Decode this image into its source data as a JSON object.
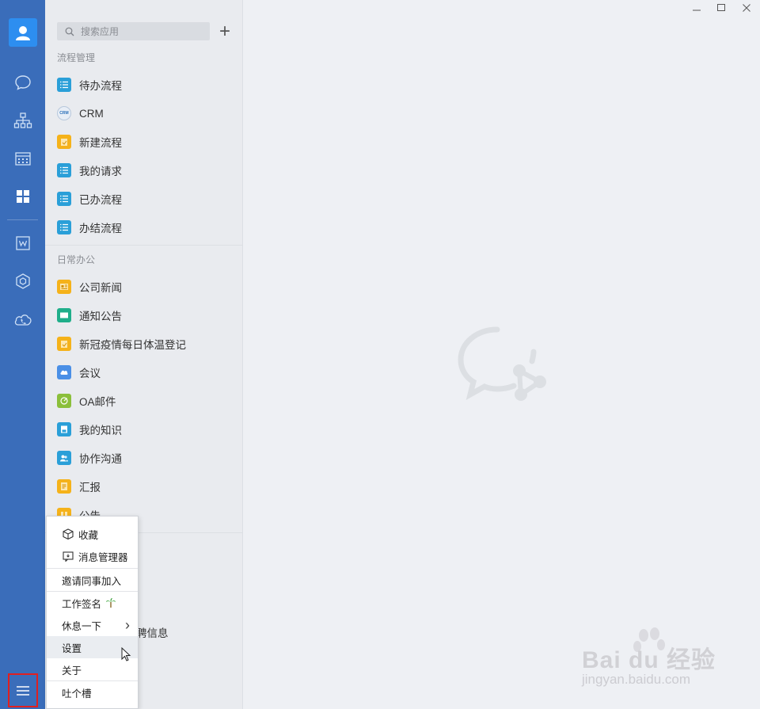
{
  "window": {
    "minimize_symbol": "—",
    "maximize_symbol": "☐",
    "close_symbol": "✕"
  },
  "rail": {
    "items": [
      {
        "name": "chat-icon"
      },
      {
        "name": "org-chart-icon"
      },
      {
        "name": "calendar-icon"
      },
      {
        "name": "apps-grid-icon"
      },
      {
        "name": "doc-w-icon"
      },
      {
        "name": "cube-icon"
      },
      {
        "name": "phone-cloud-icon"
      }
    ]
  },
  "panel": {
    "search_placeholder": "搜索应用",
    "add_symbol": "+",
    "sections": [
      {
        "title": "流程管理",
        "items": [
          {
            "label": "待办流程",
            "color": "#2a9fd8",
            "icon": "list-icon"
          },
          {
            "label": "CRM",
            "color": "#e8eef6",
            "icon": "crm-icon"
          },
          {
            "label": "新建流程",
            "color": "#f5b21a",
            "icon": "doc-edit-icon"
          },
          {
            "label": "我的请求",
            "color": "#2a9fd8",
            "icon": "list-icon"
          },
          {
            "label": "已办流程",
            "color": "#2a9fd8",
            "icon": "list-icon"
          },
          {
            "label": "办结流程",
            "color": "#2a9fd8",
            "icon": "list-icon"
          }
        ]
      },
      {
        "title": "日常办公",
        "items": [
          {
            "label": "公司新闻",
            "color": "#f5b21a",
            "icon": "news-icon"
          },
          {
            "label": "通知公告",
            "color": "#1fae8a",
            "icon": "notice-icon"
          },
          {
            "label": "新冠疫情每日体温登记",
            "color": "#f5b21a",
            "icon": "doc-edit-icon"
          },
          {
            "label": "会议",
            "color": "#4a8fe6",
            "icon": "meeting-cloud-icon"
          },
          {
            "label": "OA邮件",
            "color": "#8bbf3b",
            "icon": "mail-icon"
          },
          {
            "label": "我的知识",
            "color": "#2a9fd8",
            "icon": "knowledge-icon"
          },
          {
            "label": "协作沟通",
            "color": "#2a9fd8",
            "icon": "collab-icon"
          },
          {
            "label": "汇报",
            "color": "#f5b21a",
            "icon": "report-icon"
          },
          {
            "label": "公告",
            "color": "#f5b21a",
            "icon": "announce-icon"
          }
        ]
      }
    ],
    "occluded_text": "聘信息"
  },
  "popup": {
    "items": [
      {
        "label": "收藏",
        "icon": "box-icon"
      },
      {
        "label": "消息管理器",
        "icon": "message-manager-icon"
      },
      {
        "label": "邀请同事加入"
      },
      {
        "label": "工作签名",
        "icon": "palm-tree-icon"
      },
      {
        "label": "休息一下",
        "submenu": "›"
      },
      {
        "label": "设置"
      },
      {
        "label": "关于"
      },
      {
        "label": "吐个槽"
      }
    ]
  },
  "watermark": {
    "brand": "Bai du 经验",
    "url": "jingyan.baidu.com"
  }
}
